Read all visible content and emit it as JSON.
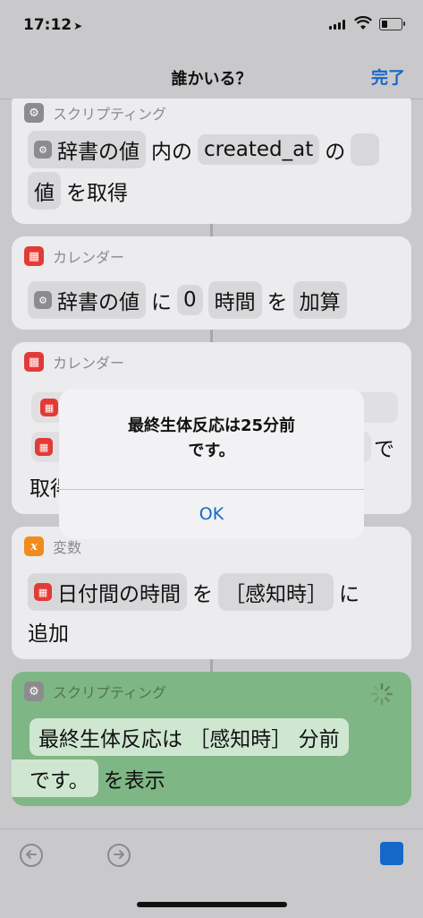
{
  "status": {
    "time": "17:12",
    "location_icon": "location-arrow-icon"
  },
  "nav": {
    "title": "誰かいる？",
    "done": "完了"
  },
  "cards": [
    {
      "category": "スクリプティング",
      "row1": [
        "辞書の値",
        "内の",
        "created_at",
        "の"
      ],
      "row2": [
        "値",
        "を取得"
      ]
    },
    {
      "category": "カレンダー",
      "row1": [
        "辞書の値",
        "に",
        "0",
        "時間",
        "を",
        "加算"
      ]
    },
    {
      "category": "カレンダー",
      "row2_tail": "で",
      "row3_head": "取得"
    },
    {
      "category": "変数",
      "row1": [
        "日付間の時間",
        "を",
        "［感知時］",
        "に"
      ],
      "row2": [
        "追加"
      ]
    },
    {
      "category": "スクリプティング",
      "row1": [
        "最終生体反応は ［感知時］ 分前"
      ],
      "row2": [
        "です。",
        "を表示"
      ]
    }
  ],
  "alert": {
    "line1": "最終生体反応は25分前",
    "line2": "です。",
    "button": "OK"
  },
  "colors": {
    "accent": "#1668c8",
    "green_card": "#7fb685",
    "calendar_red": "#e23b36",
    "variable_orange": "#f08b1c"
  }
}
